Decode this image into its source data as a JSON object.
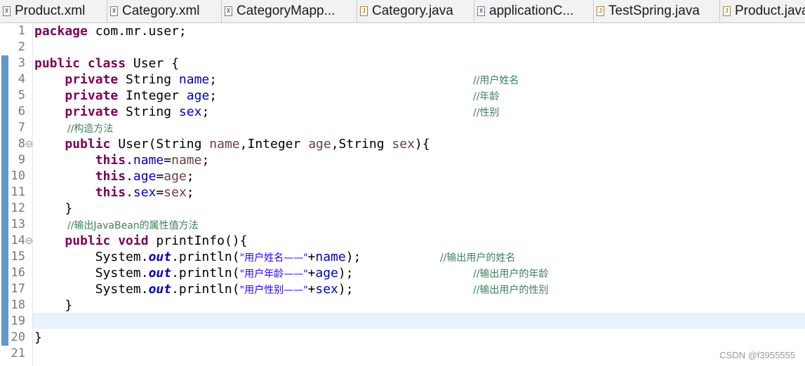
{
  "tabs": [
    {
      "label": "Product.xml",
      "icon": "xml-file-icon"
    },
    {
      "label": "Category.xml",
      "icon": "xml-file-icon"
    },
    {
      "label": "CategoryMapp...",
      "icon": "xml-file-icon"
    },
    {
      "label": "Category.java",
      "icon": "java-file-icon"
    },
    {
      "label": "applicationC...",
      "icon": "xml-file-icon"
    },
    {
      "label": "TestSpring.java",
      "icon": "java-file-icon"
    },
    {
      "label": "Product.java",
      "icon": "java-file-icon"
    }
  ],
  "line_numbers": [
    "1",
    "2",
    "3",
    "4",
    "5",
    "6",
    "7",
    "8",
    "9",
    "10",
    "11",
    "12",
    "13",
    "14",
    "15",
    "16",
    "17",
    "18",
    "19",
    "20",
    "21"
  ],
  "code": {
    "l1": {
      "kw": "package",
      "rest": " com.mr.user;"
    },
    "l3": {
      "kw": "public class",
      "rest": " User {"
    },
    "l4": {
      "kw": "private",
      "type": " String ",
      "var": "name",
      "end": ";",
      "comment": "//用户姓名"
    },
    "l5": {
      "kw": "private",
      "type": " Integer ",
      "var": "age",
      "end": ";",
      "comment": "//年龄"
    },
    "l6": {
      "kw": "private",
      "type": " String ",
      "var": "sex",
      "end": ";",
      "comment": "//性别"
    },
    "l7": {
      "comment": "//构造方法"
    },
    "l8": {
      "kw": "public",
      "a": " User(String ",
      "p1": "name",
      "b": ",Integer ",
      "p2": "age",
      "c": ",String ",
      "p3": "sex",
      "d": "){"
    },
    "l9": {
      "kw": "this",
      "dot": ".",
      "fld": "name",
      "eq": "=",
      "val": "name",
      "end": ";"
    },
    "l10": {
      "kw": "this",
      "dot": ".",
      "fld": "age",
      "eq": "=",
      "val": "age",
      "end": ";"
    },
    "l11": {
      "kw": "this",
      "dot": ".",
      "fld": "sex",
      "eq": "=",
      "val": "sex",
      "end": ";"
    },
    "l12": {
      "text": "}"
    },
    "l13": {
      "comment": "//输出JavaBean的属性值方法"
    },
    "l14": {
      "kw": "public void",
      "rest": " printInfo(){"
    },
    "l15": {
      "a": "System.",
      "out": "out",
      "b": ".println(",
      "str": "\"用户姓名——\"",
      "c": "+",
      "fld": "name",
      "d": ");",
      "comment": "//输出用户的姓名"
    },
    "l16": {
      "a": "System.",
      "out": "out",
      "b": ".println(",
      "str": "\"用户年龄——\"",
      "c": "+",
      "fld": "age",
      "d": ");",
      "comment": "//输出用户的年龄"
    },
    "l17": {
      "a": "System.",
      "out": "out",
      "b": ".println(",
      "str": "\"用户性别——\"",
      "c": "+",
      "fld": "sex",
      "d": ");",
      "comment": "//输出用户的性别"
    },
    "l18": {
      "text": "}"
    },
    "l20": {
      "text": "}"
    }
  },
  "watermark": "CSDN @f3955555",
  "colors": {
    "keyword": "#7f0055",
    "field": "#0000c0",
    "parameter": "#6a3e3e",
    "string": "#2a00ff",
    "comment": "#3f7f5f",
    "current_line": "#e8f2fe",
    "ruler_bar": "#5f98c9"
  }
}
